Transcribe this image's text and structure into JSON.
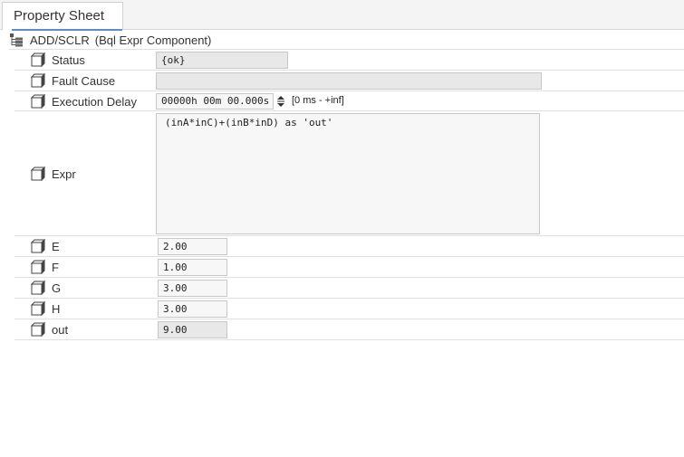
{
  "tab": {
    "label": "Property Sheet"
  },
  "header": {
    "title": "ADD/SCLR",
    "type": "(Bql Expr Component)"
  },
  "rows": {
    "status": {
      "label": "Status",
      "value": "{ok}"
    },
    "fault_cause": {
      "label": "Fault Cause",
      "value": ""
    },
    "execution_delay": {
      "label": "Execution Delay",
      "value": "00000h 00m 00.000s",
      "range": "[0 ms - +inf]"
    },
    "expr": {
      "label": "Expr",
      "value": "(inA*inC)+(inB*inD) as 'out'"
    },
    "e": {
      "label": "E",
      "value": "2.00"
    },
    "f": {
      "label": "F",
      "value": "1.00"
    },
    "g": {
      "label": "G",
      "value": "3.00"
    },
    "h": {
      "label": "H",
      "value": "3.00"
    },
    "out": {
      "label": "out",
      "value": "9.00"
    }
  },
  "icons": {
    "property": "slot-cube-icon",
    "tree": "tree-node-icon"
  }
}
